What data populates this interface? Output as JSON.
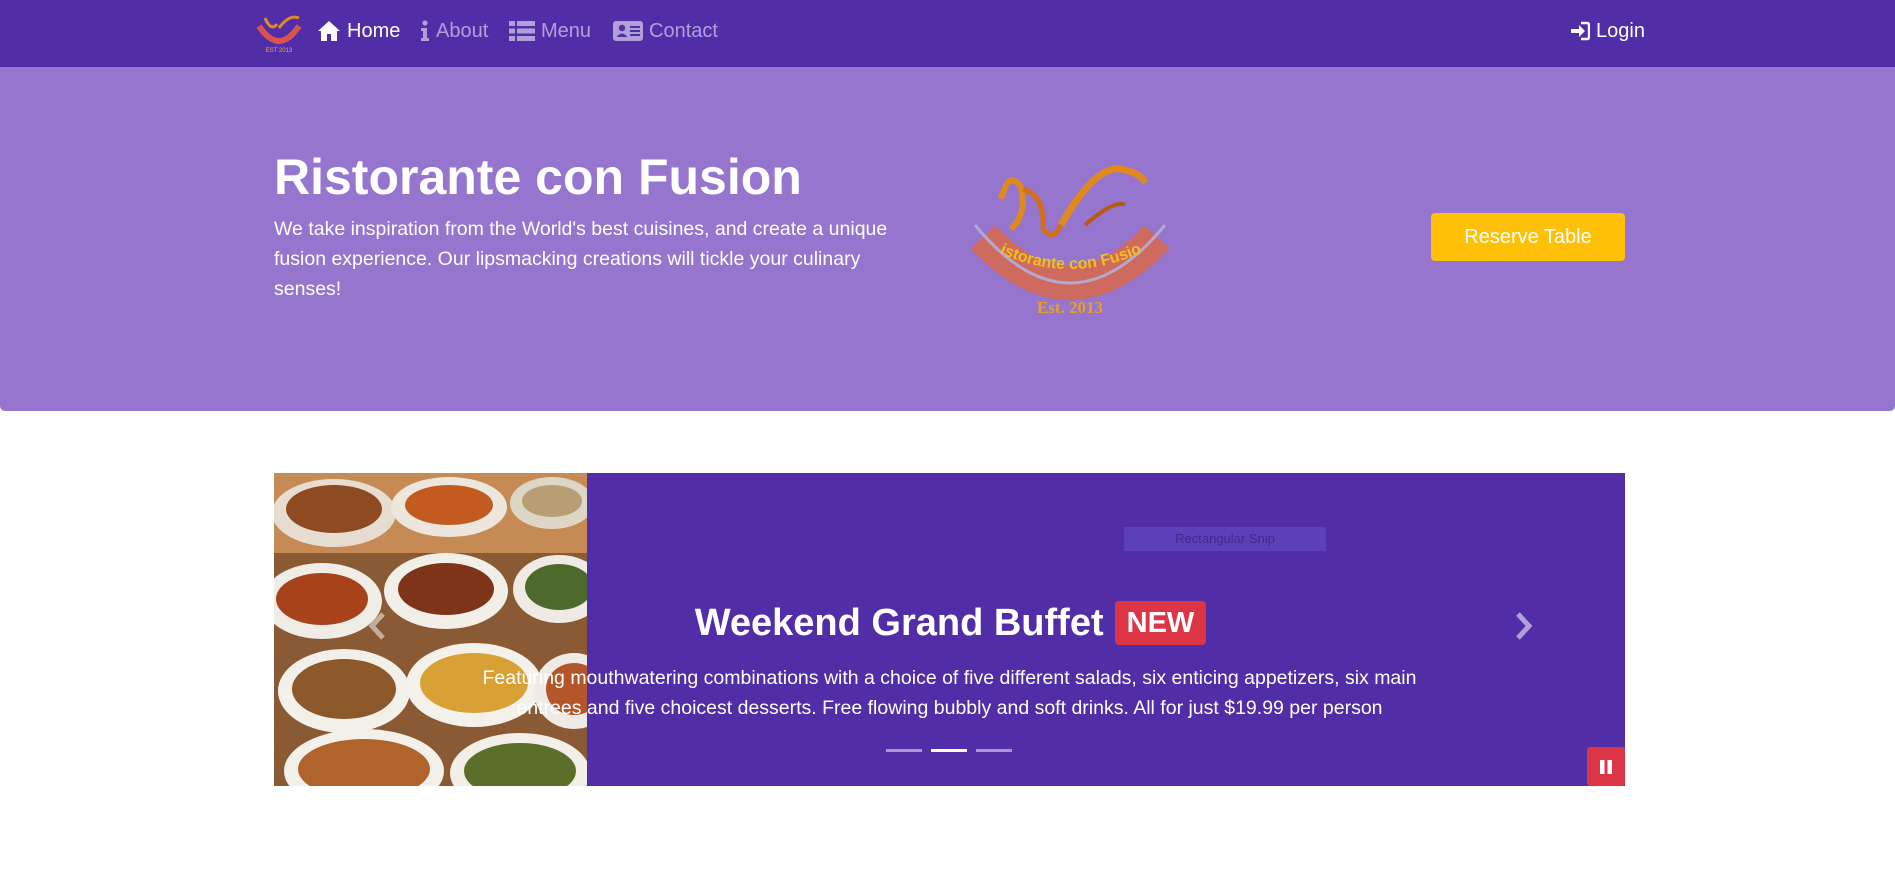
{
  "navbar": {
    "items": [
      {
        "label": "Home",
        "icon": "home-icon",
        "active": true
      },
      {
        "label": "About",
        "icon": "info-icon",
        "active": false
      },
      {
        "label": "Menu",
        "icon": "list-icon",
        "active": false
      },
      {
        "label": "Contact",
        "icon": "address-card-icon",
        "active": false
      }
    ],
    "login_label": "Login"
  },
  "hero": {
    "title": "Ristorante con Fusion",
    "description": "We take inspiration from the World's best cuisines, and create a unique fusion experience. Our lipsmacking creations will tickle your culinary senses!",
    "logo_text": "Ristorante con Fusion",
    "logo_est": "Est. 2013",
    "reserve_label": "Reserve Table"
  },
  "carousel": {
    "title": "Weekend Grand Buffet",
    "badge": "NEW",
    "description": "Featuring mouthwatering combinations with a choice of five different salads, six enticing appetizers, six main entrees and five choicest desserts. Free flowing bubbly and soft drinks. All for just $19.99 per person",
    "overlay_label": "Rectangular Snip",
    "active_slide": 2,
    "slide_count": 3
  },
  "colors": {
    "navbar": "#512da8",
    "jumbotron": "#9575cd",
    "carousel": "#512da8",
    "reserve_button": "#ffc107",
    "badge": "#dc3545",
    "pause_button": "#dc3545"
  }
}
